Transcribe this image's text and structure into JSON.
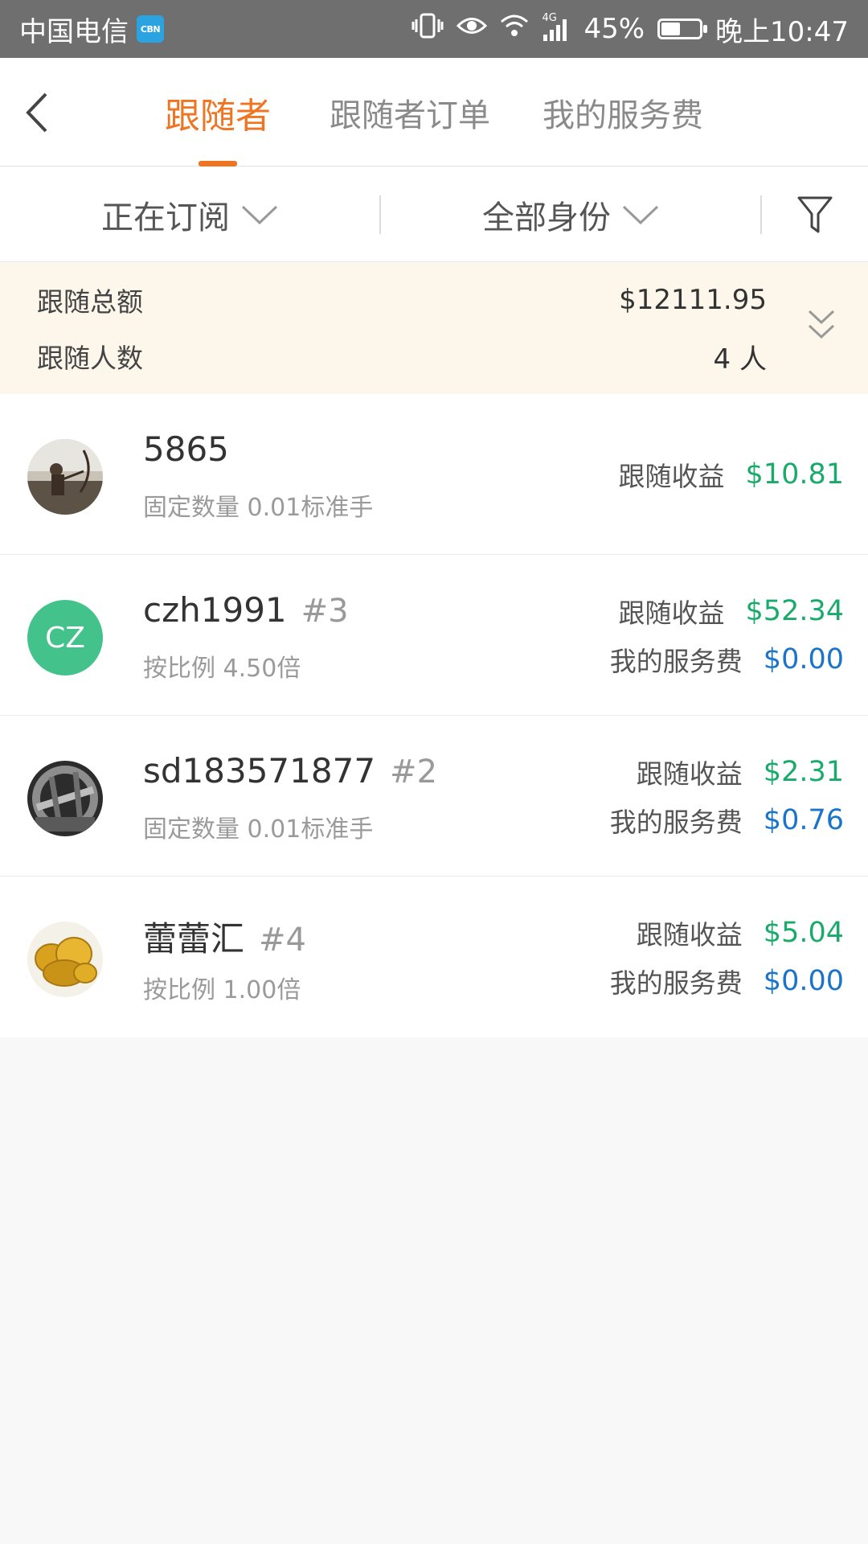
{
  "status_bar": {
    "carrier": "中国电信",
    "badge": "CBN",
    "battery": "45%",
    "battery_level": 0.45,
    "time": "晚上10:47",
    "network": "4G"
  },
  "tabs": [
    {
      "label": "跟随者",
      "active": true
    },
    {
      "label": "跟随者订单",
      "active": false
    },
    {
      "label": "我的服务费",
      "active": false
    }
  ],
  "filters": {
    "status": "正在订阅",
    "identity": "全部身份"
  },
  "summary": {
    "total_label": "跟随总额",
    "total_value": "$12111.95",
    "count_label": "跟随人数",
    "count_value": "4 人"
  },
  "followers": [
    {
      "name": "5865",
      "rank": "",
      "subtext": "固定数量 0.01标准手",
      "avatar": "photo-archer",
      "profit_label": "跟随收益",
      "profit": "$10.81"
    },
    {
      "name": "czh1991",
      "rank": "#3",
      "subtext": "按比例 4.50倍",
      "avatar": "CZ",
      "profit_label": "跟随收益",
      "profit": "$52.34",
      "fee_label": "我的服务费",
      "fee": "$0.00"
    },
    {
      "name": "sd183571877",
      "rank": "#2",
      "subtext": "固定数量 0.01标准手",
      "avatar": "photo-stone",
      "profit_label": "跟随收益",
      "profit": "$2.31",
      "fee_label": "我的服务费",
      "fee": "$0.76"
    },
    {
      "name": "蕾蕾汇",
      "rank": "#4",
      "subtext": "按比例 1.00倍",
      "avatar": "photo-coins",
      "profit_label": "跟随收益",
      "profit": "$5.04",
      "fee_label": "我的服务费",
      "fee": "$0.00"
    }
  ],
  "colors": {
    "accent": "#ef7522",
    "profit": "#1aab6c",
    "fee": "#1b74c9",
    "summary_bg": "#fdf6ea"
  }
}
